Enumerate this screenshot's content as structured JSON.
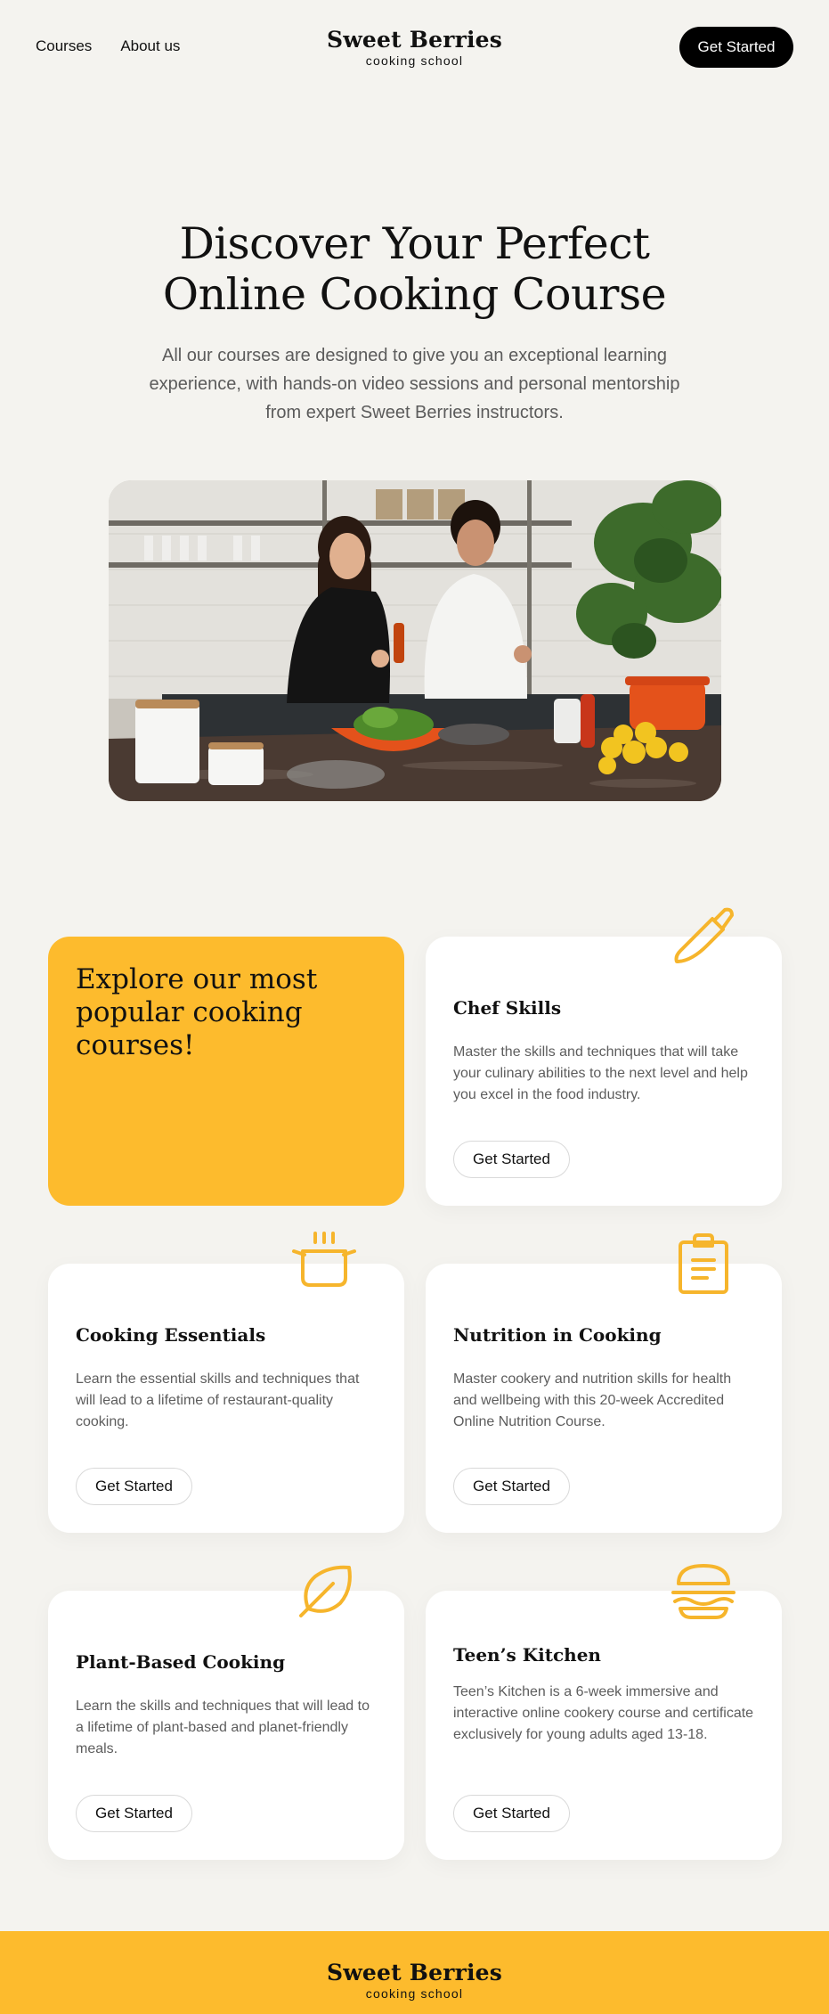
{
  "header": {
    "nav": [
      "Courses",
      "About us"
    ],
    "logo_title": "Sweet Berries",
    "logo_subtitle": "cooking school",
    "cta_label": "Get Started"
  },
  "hero": {
    "title_line1": "Discover Your Perfect",
    "title_line2": "Online Cooking Course",
    "subtitle": "All our courses are designed to give you an exceptional learning experience, with hands-on video sessions and personal mentorship from expert Sweet Berries instructors."
  },
  "promo": {
    "title": "Explore our most popular cooking courses!"
  },
  "courses": [
    {
      "icon": "chef-knife-icon",
      "title": "Chef Skills",
      "description": "Master the skills and techniques that will take your culinary abilities to the next level and help you excel in the food industry.",
      "button": "Get Started"
    },
    {
      "icon": "cooking-pot-icon",
      "title": "Cooking Essentials",
      "description": "Learn the essential skills and techniques that will lead to a lifetime of restaurant-quality cooking.",
      "button": "Get Started"
    },
    {
      "icon": "clipboard-icon",
      "title": "Nutrition in Cooking",
      "description": "Master cookery and nutrition skills for health and wellbeing with this 20-week Accredited Online Nutrition Course.",
      "button": "Get Started"
    },
    {
      "icon": "leaf-icon",
      "title": "Plant-Based Cooking",
      "description": "Learn the skills and techniques that will lead to a lifetime of plant-based and planet-friendly meals.",
      "button": "Get Started"
    },
    {
      "icon": "burger-icon",
      "title": "Teen’s Kitchen",
      "description": "Teen’s Kitchen is a 6-week immersive and interactive online cookery course and certificate exclusively for young adults aged 13-18.",
      "button": "Get Started"
    }
  ],
  "footer": {
    "logo_title": "Sweet Berries",
    "logo_subtitle": "cooking school"
  },
  "colors": {
    "accent": "#fdbb2d",
    "background": "#f4f3ef",
    "icon": "#f6b52c"
  }
}
